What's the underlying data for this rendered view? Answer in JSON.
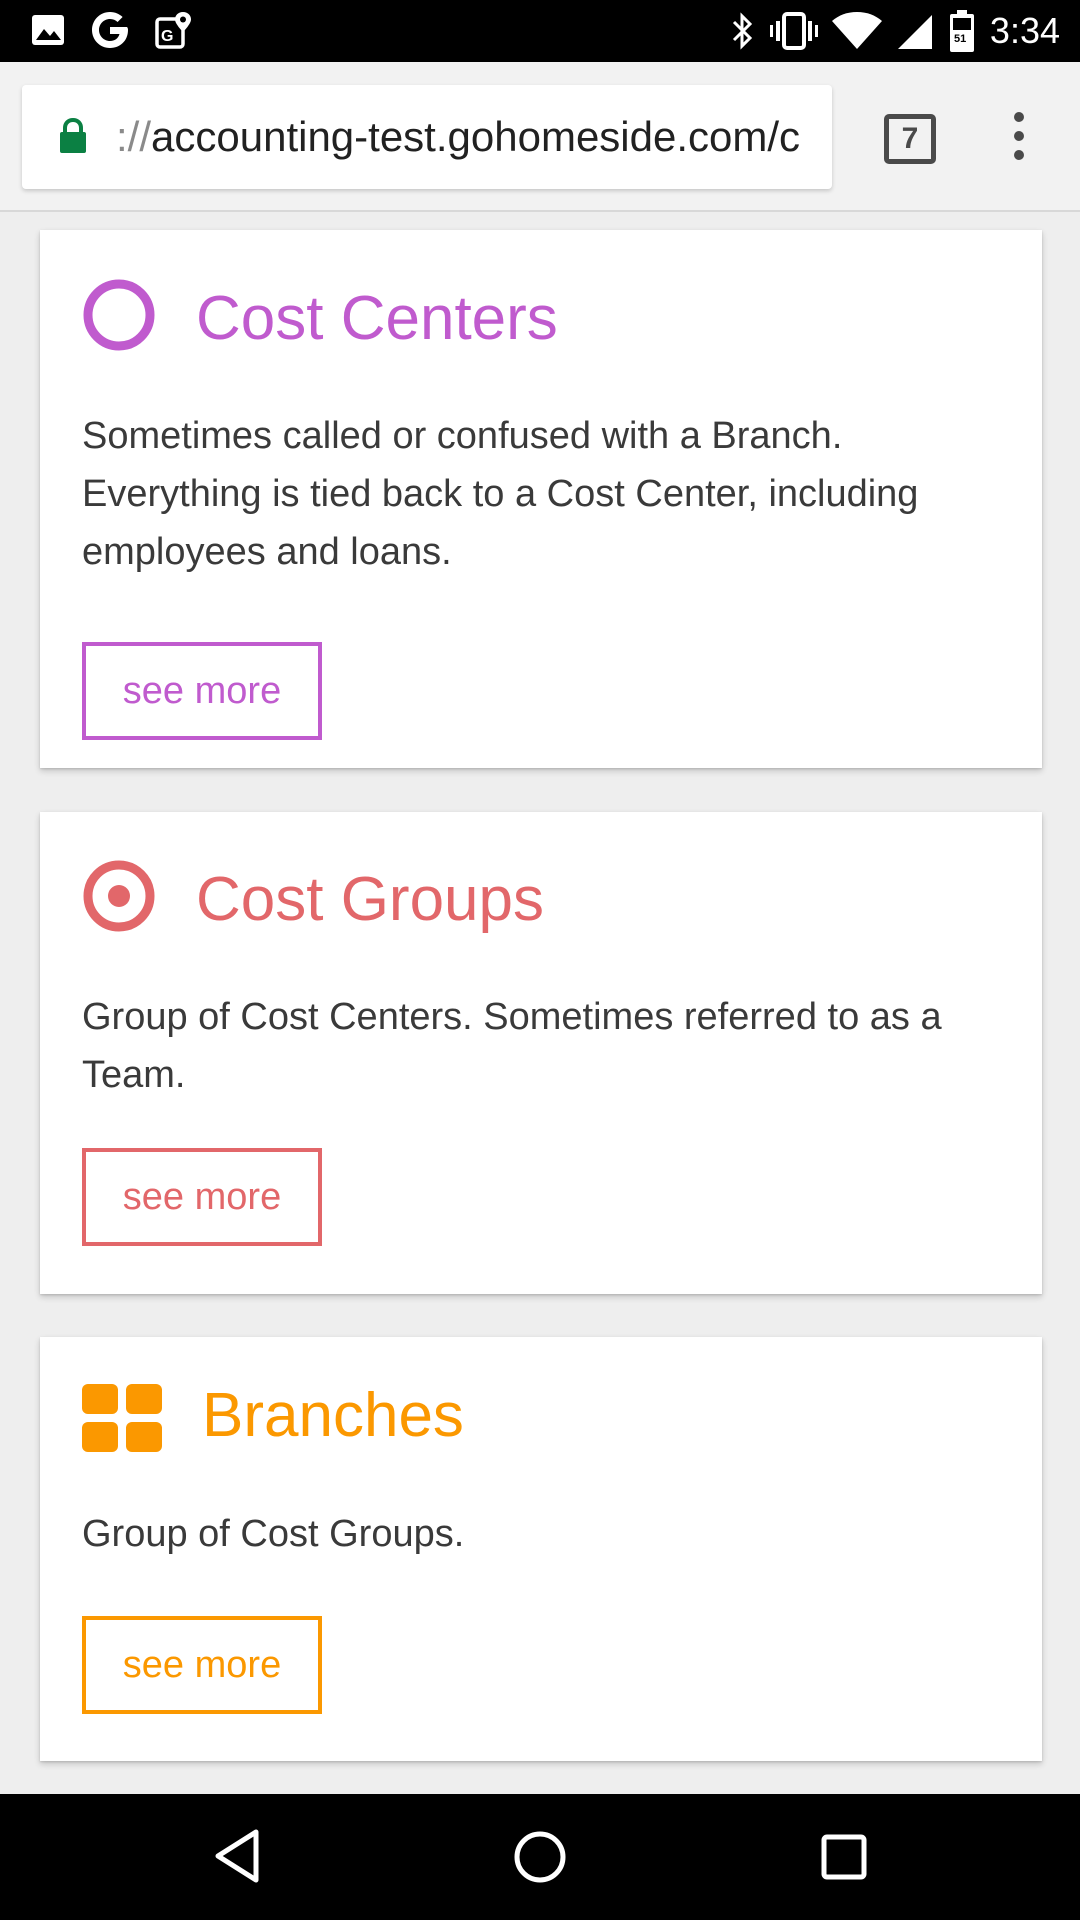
{
  "status_bar": {
    "time": "3:34",
    "left_icons": [
      "image-icon",
      "google-icon",
      "maps-icon"
    ],
    "right_icons": [
      "bluetooth-icon",
      "vibrate-icon",
      "wifi-icon",
      "signal-icon",
      "battery-icon"
    ]
  },
  "browser": {
    "url_scheme": "://",
    "url_host": "accounting-test.gohomeside.com/c",
    "tab_count": "7"
  },
  "cards": [
    {
      "title": "Cost Centers",
      "icon": "ring-icon",
      "color": "#c05bce",
      "description": "Sometimes called or confused with a Branch. Everything is tied back to a Cost Center, including employees and loans.",
      "button": "see more"
    },
    {
      "title": "Cost Groups",
      "icon": "target-icon",
      "color": "#e2676a",
      "description": "Group of Cost Centers. Sometimes referred to as a Team.",
      "button": "see more"
    },
    {
      "title": "Branches",
      "icon": "grid-icon",
      "color": "#fb9800",
      "description": "Group of Cost Groups.",
      "button": "see more"
    }
  ],
  "nav_bar": {
    "buttons": [
      "back-icon",
      "home-icon",
      "recents-icon"
    ]
  }
}
